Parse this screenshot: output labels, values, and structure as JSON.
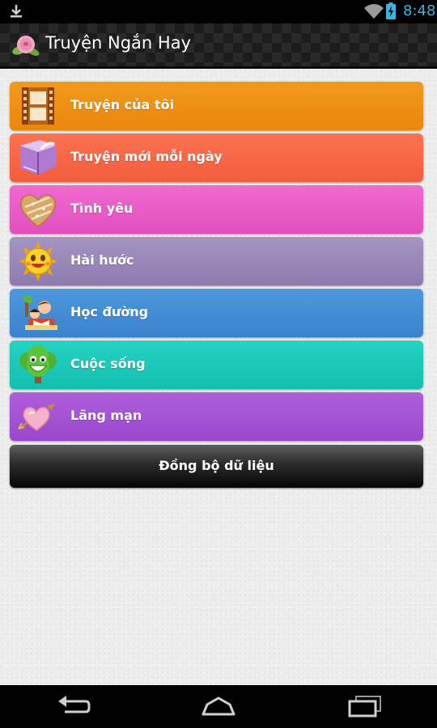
{
  "status_bar": {
    "time": "8:48",
    "icons": [
      "download-icon",
      "wifi-icon",
      "battery-icon"
    ],
    "accent_color": "#33b5e5"
  },
  "app": {
    "title": "Truyện Ngắn Hay",
    "logo_icon": "rose-icon"
  },
  "menu": {
    "items": [
      {
        "label": "Truyện của tôi",
        "icon": "film-strip-icon",
        "colors": [
          "#f29a1c",
          "#ea860d"
        ]
      },
      {
        "label": "Truyện mới mỗi ngày",
        "icon": "book-icon",
        "colors": [
          "#fb7350",
          "#f35c3e"
        ]
      },
      {
        "label": "Tình yêu",
        "icon": "heart-icon",
        "colors": [
          "#f06ad0",
          "#e24fbf"
        ]
      },
      {
        "label": "Hài hước",
        "icon": "smiling-sun-icon",
        "colors": [
          "#a595c2",
          "#8d7bae"
        ]
      },
      {
        "label": "Học đường",
        "icon": "students-reading-icon",
        "colors": [
          "#4c98dc",
          "#3b82cd"
        ]
      },
      {
        "label": "Cuộc sống",
        "icon": "smiling-tree-icon",
        "colors": [
          "#26d3c2",
          "#12bfb0"
        ]
      },
      {
        "label": "Lãng mạn",
        "icon": "heart-arrow-icon",
        "colors": [
          "#ae5fdc",
          "#9a47cc"
        ]
      }
    ]
  },
  "sync_button": {
    "label": "Đồng bộ dữ liệu"
  },
  "nav_bar": {
    "icons": [
      "back-icon",
      "home-icon",
      "recent-apps-icon"
    ]
  }
}
